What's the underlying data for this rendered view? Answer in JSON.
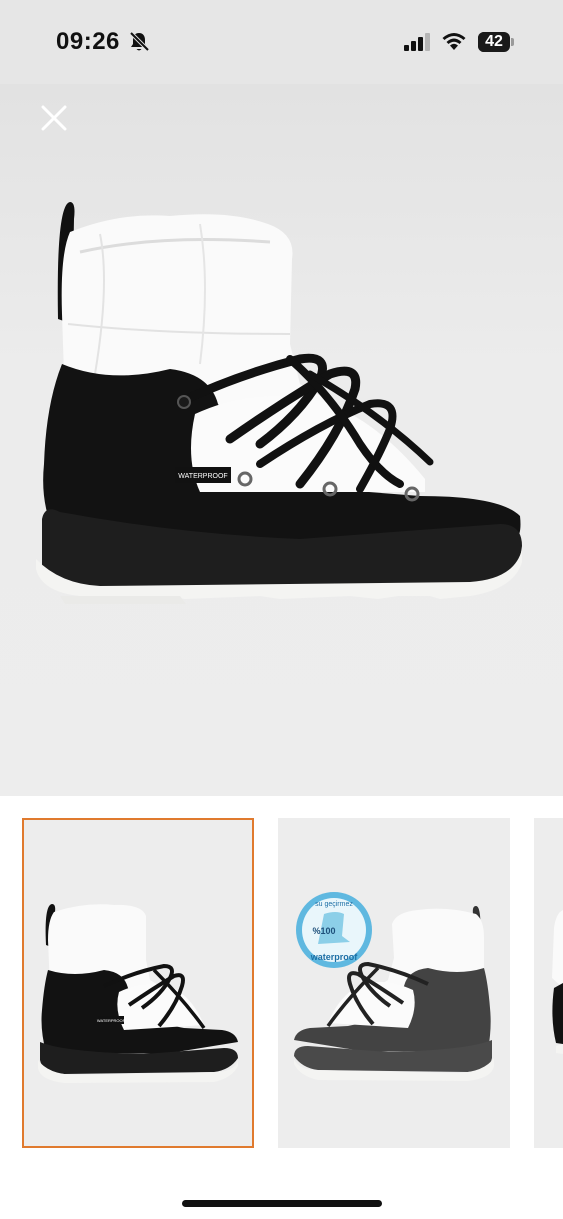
{
  "status_bar": {
    "time": "09:26",
    "battery": "42",
    "battery_level": 0.42,
    "icons": [
      "bell-slash-icon",
      "cellular-signal-icon",
      "wifi-icon",
      "battery-icon"
    ]
  },
  "viewer": {
    "close_icon": "close-icon",
    "main_image_label": "WATERPROOF"
  },
  "thumbnails": [
    {
      "selected": true,
      "label": "WATERPROOF"
    },
    {
      "selected": false,
      "badge_top": "su geçirmez",
      "badge_pct": "%100",
      "badge_bottom": "waterproof"
    },
    {
      "selected": false
    }
  ],
  "colors": {
    "selected_border": "#e07a2e",
    "background": "#ededed"
  }
}
